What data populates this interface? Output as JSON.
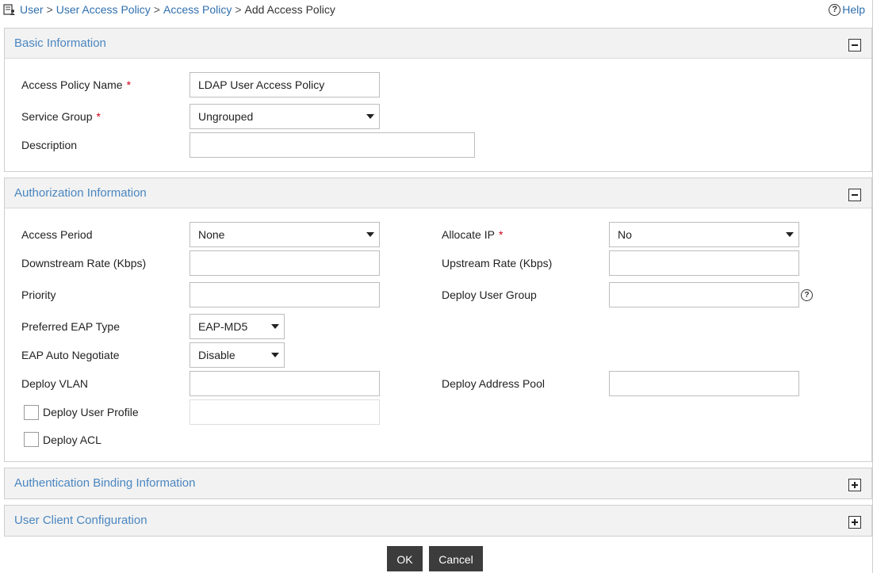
{
  "breadcrumb": {
    "items": [
      "User",
      "User Access Policy",
      "Access Policy"
    ],
    "separator": ">",
    "current": "Add Access Policy"
  },
  "help": {
    "label": "Help",
    "icon": "question-circle-icon"
  },
  "basic": {
    "title": "Basic Information",
    "toggle": "collapse-icon",
    "policy_name": {
      "label": "Access Policy Name",
      "required": "*",
      "value": "LDAP User Access Policy"
    },
    "service_group": {
      "label": "Service Group",
      "required": "*",
      "value": "Ungrouped"
    },
    "description": {
      "label": "Description",
      "value": ""
    }
  },
  "auth": {
    "title": "Authorization Information",
    "toggle": "collapse-icon",
    "access_period": {
      "label": "Access Period",
      "value": "None"
    },
    "allocate_ip": {
      "label": "Allocate IP",
      "required": "*",
      "value": "No"
    },
    "downstream_rate": {
      "label": "Downstream Rate (Kbps)",
      "value": ""
    },
    "upstream_rate": {
      "label": "Upstream Rate (Kbps)",
      "value": ""
    },
    "priority": {
      "label": "Priority",
      "value": ""
    },
    "deploy_user_group": {
      "label": "Deploy User Group",
      "value": ""
    },
    "preferred_eap": {
      "label": "Preferred EAP Type",
      "value": "EAP-MD5"
    },
    "eap_auto": {
      "label": "EAP Auto Negotiate",
      "value": "Disable"
    },
    "deploy_vlan": {
      "label": "Deploy VLAN",
      "value": ""
    },
    "deploy_address_pool": {
      "label": "Deploy Address Pool",
      "value": ""
    },
    "deploy_user_profile": {
      "label": "Deploy User Profile",
      "checked": false,
      "value": ""
    },
    "deploy_acl": {
      "label": "Deploy ACL",
      "checked": false
    }
  },
  "binding": {
    "title": "Authentication Binding Information",
    "toggle": "expand-icon"
  },
  "client": {
    "title": "User Client Configuration",
    "toggle": "expand-icon"
  },
  "buttons": {
    "ok": "OK",
    "cancel": "Cancel"
  }
}
